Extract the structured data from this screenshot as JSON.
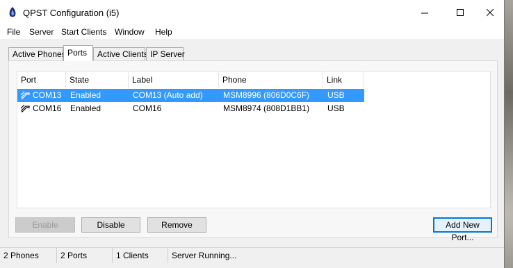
{
  "window": {
    "title": "QPST Configuration (i5)"
  },
  "menu": [
    "File",
    "Server",
    "Start Clients",
    "Window",
    "Help"
  ],
  "tabs": [
    "Active Phones",
    "Ports",
    "Active Clients",
    "IP Server"
  ],
  "active_tab": "Ports",
  "columns": [
    "Port",
    "State",
    "Label",
    "Phone",
    "Link"
  ],
  "rows": [
    {
      "port": "COM13",
      "state": "Enabled",
      "label": "COM13 (Auto add)",
      "phone": "MSM8996 (806D0C6F)",
      "link": "USB",
      "selected": true
    },
    {
      "port": "COM16",
      "state": "Enabled",
      "label": "COM16",
      "phone": "MSM8974 (808D1BB1)",
      "link": "USB",
      "selected": false
    }
  ],
  "buttons": {
    "enable": "Enable",
    "disable": "Disable",
    "remove": "Remove",
    "add_new_port": "Add New Port..."
  },
  "status": {
    "phones": "2 Phones",
    "ports": "2 Ports",
    "clients": "1 Clients",
    "server": "Server Running..."
  },
  "colors": {
    "selection": "#3399ff",
    "default_button_border": "#0078d7"
  },
  "icons": {
    "app": "qpst-app-icon",
    "port": "usb-port-icon"
  }
}
